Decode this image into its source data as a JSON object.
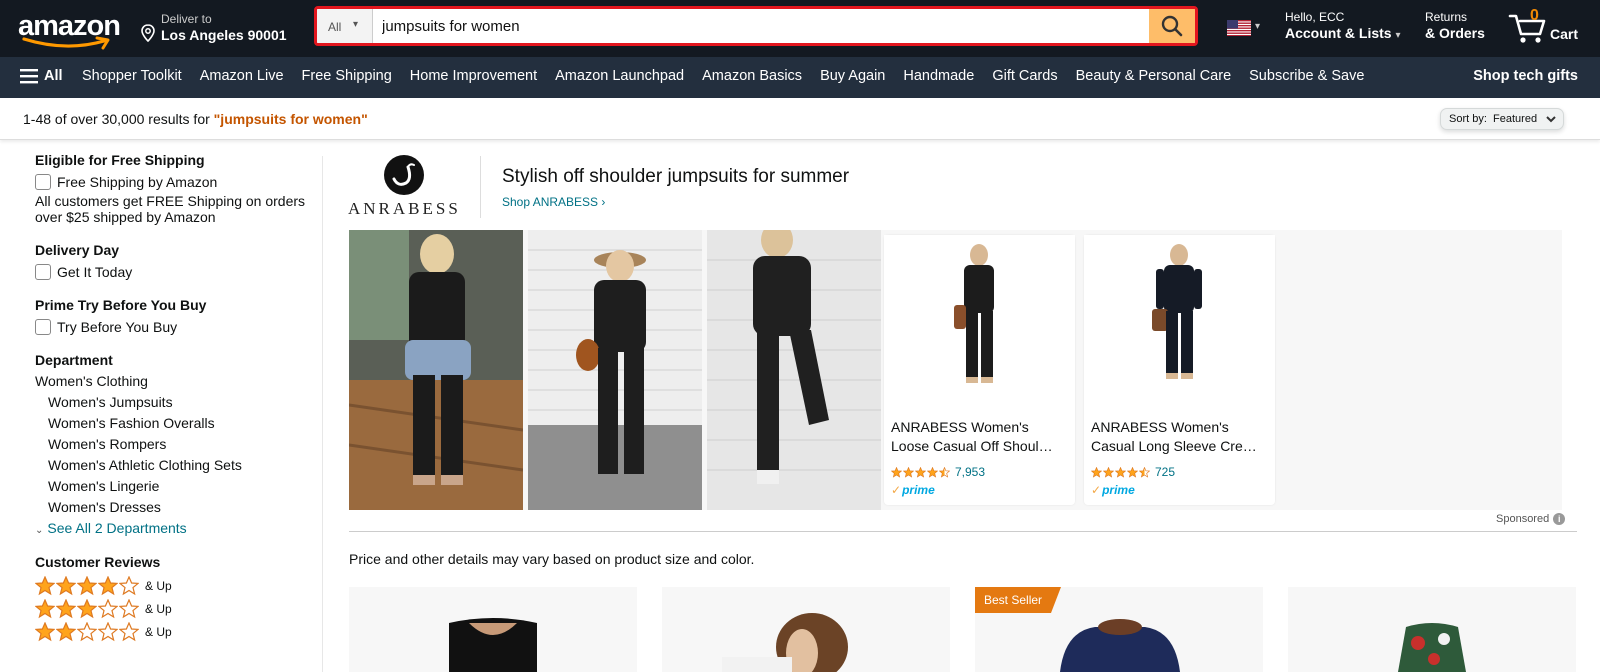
{
  "header": {
    "logo_text": "amazon",
    "deliver_label": "Deliver to",
    "deliver_location": "Los Angeles 90001",
    "search": {
      "category": "All",
      "query": "jumpsuits for women"
    },
    "greeting": "Hello, ECC",
    "account_label": "Account & Lists",
    "returns_label": "Returns",
    "orders_label": "& Orders",
    "cart_count": "0",
    "cart_label": "Cart"
  },
  "subnav": {
    "all_label": "All",
    "links": [
      "Shopper Toolkit",
      "Amazon Live",
      "Free Shipping",
      "Home Improvement",
      "Amazon Launchpad",
      "Amazon Basics",
      "Buy Again",
      "Handmade",
      "Gift Cards",
      "Beauty & Personal Care",
      "Subscribe & Save"
    ],
    "promo": "Shop tech gifts"
  },
  "results": {
    "summary": "1-48 of over 30,000 results for ",
    "query_quoted": "\"jumpsuits for women\"",
    "sort_label": "Sort by:",
    "sort_value": "Featured"
  },
  "sidebar": {
    "free_shipping_heading": "Eligible for Free Shipping",
    "free_shipping_option": "Free Shipping by Amazon",
    "free_shipping_note": "All customers get FREE Shipping on orders over $25 shipped by Amazon",
    "delivery_heading": "Delivery Day",
    "delivery_option": "Get It Today",
    "prime_heading": "Prime Try Before You Buy",
    "prime_option": "Try Before You Buy",
    "department_heading": "Department",
    "department_top": "Women's Clothing",
    "departments": [
      "Women's Jumpsuits",
      "Women's Fashion Overalls",
      "Women's Rompers",
      "Women's Athletic Clothing Sets",
      "Women's Lingerie",
      "Women's Dresses"
    ],
    "see_all": "See All 2 Departments",
    "reviews_heading": "Customer Reviews",
    "review_rows": [
      {
        "stars": 4,
        "label": "& Up"
      },
      {
        "stars": 3,
        "label": "& Up"
      },
      {
        "stars": 2,
        "label": "& Up"
      }
    ]
  },
  "sponsored_brand": {
    "brand_name": "ANRABESS",
    "headline": "Stylish off shoulder jumpsuits for summer",
    "shop_link": "Shop ANRABESS ›",
    "cards": [
      {
        "title": "ANRABESS Women's Loose Casual Off Shoul…",
        "rating": 4.5,
        "reviews": "7,953",
        "prime": "prime"
      },
      {
        "title": "ANRABESS Women's Casual Long Sleeve Cre…",
        "rating": 4.5,
        "reviews": "725",
        "prime": "prime"
      }
    ],
    "sponsored_label": "Sponsored"
  },
  "price_note": "Price and other details may vary based on product size and color.",
  "products": [
    {
      "badge": ""
    },
    {
      "badge": ""
    },
    {
      "badge": "Best Seller"
    },
    {
      "badge": ""
    }
  ],
  "colors": {
    "nav_bg": "#131921",
    "subnav_bg": "#232f3e",
    "search_btn": "#febd69",
    "query_accent": "#c45500",
    "link": "#007185",
    "badge": "#e47911",
    "star": "#ffa41c"
  }
}
